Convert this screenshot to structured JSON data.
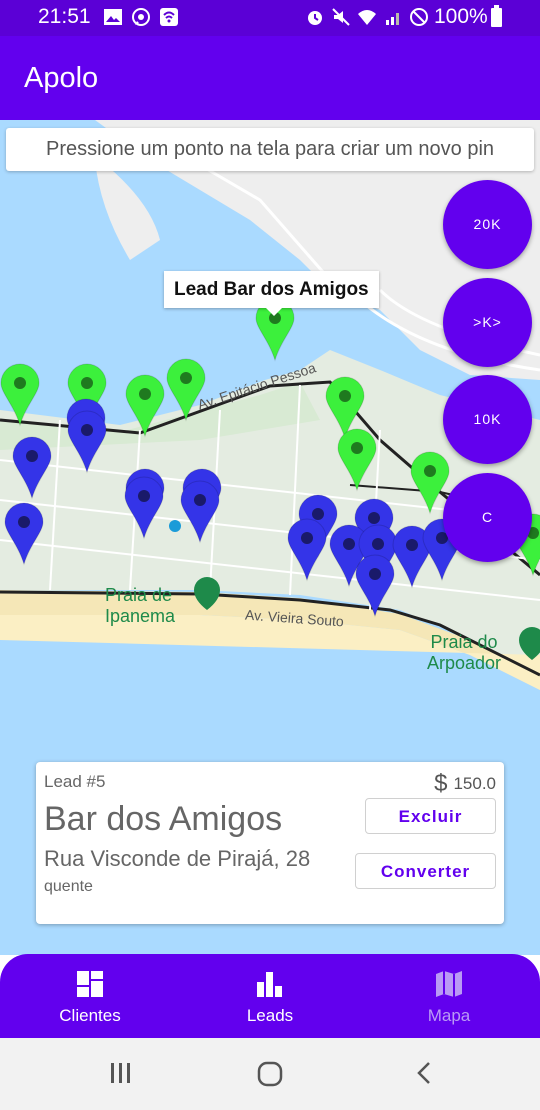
{
  "status_bar": {
    "time": "21:51",
    "battery": "100%"
  },
  "app_bar": {
    "title": "Apolo"
  },
  "map": {
    "hint": "Pressione um ponto na tela para criar um novo pin",
    "info_window": "Lead Bar dos Amigos",
    "places": {
      "ipanema": "Praia de\nIpanema",
      "arpoador": "Praia do\nArpoador"
    },
    "streets": {
      "epitacio": "Av. Epitácio Pessoa",
      "vieira": "Av. Vieira Souto"
    },
    "pin_colors": {
      "lead": "#3cf03c",
      "client": "#3434e8"
    },
    "filters": [
      "20K",
      ">K>",
      "10K",
      "C"
    ]
  },
  "lead_card": {
    "id_label": "Lead #5",
    "currency": "$",
    "value": "150.0",
    "name": "Bar dos Amigos",
    "address": "Rua Visconde de Pirajá, 28",
    "status": "quente",
    "delete_label": "Excluir",
    "convert_label": "Converter"
  },
  "bottom_nav": {
    "items": [
      {
        "label": "Clientes",
        "icon": "dashboard-icon"
      },
      {
        "label": "Leads",
        "icon": "bar-chart-icon"
      },
      {
        "label": "Mapa",
        "icon": "map-icon"
      }
    ]
  },
  "colors": {
    "primary": "#6200ee",
    "status_bar": "#5b00d6"
  }
}
